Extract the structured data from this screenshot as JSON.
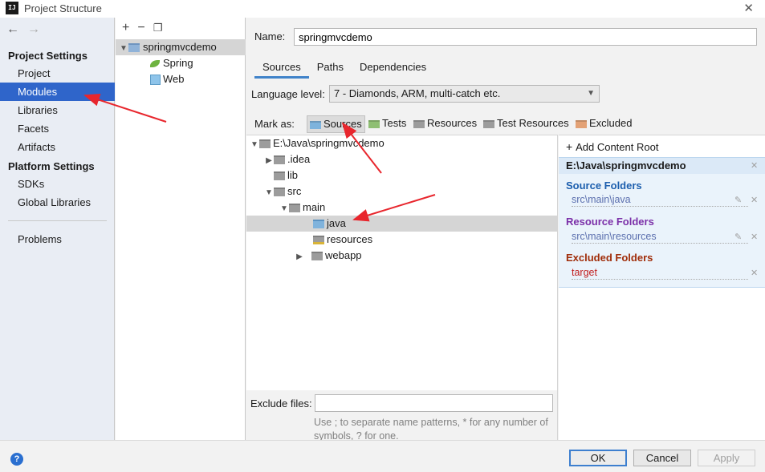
{
  "window": {
    "title": "Project Structure",
    "app_icon_text": "IJ"
  },
  "nav": {
    "back_icon": "arrow-left-icon",
    "forward_icon": "arrow-right-icon",
    "project_settings_header": "Project Settings",
    "project_settings_items": [
      "Project",
      "Modules",
      "Libraries",
      "Facets",
      "Artifacts"
    ],
    "platform_settings_header": "Platform Settings",
    "platform_settings_items": [
      "SDKs",
      "Global Libraries"
    ],
    "other_items": [
      "Problems"
    ],
    "selected": "Modules"
  },
  "modules": {
    "toolbar": {
      "add": "+",
      "remove": "−",
      "copy_icon": "copy-icon"
    },
    "tree": [
      {
        "label": "springmvcdemo",
        "icon": "module-folder-icon",
        "expanded": true,
        "selected": true
      },
      {
        "label": "Spring",
        "icon": "spring-leaf-icon"
      },
      {
        "label": "Web",
        "icon": "web-icon"
      }
    ]
  },
  "details": {
    "name_label": "Name:",
    "name_value": "springmvcdemo",
    "tabs": [
      "Sources",
      "Paths",
      "Dependencies"
    ],
    "active_tab": "Sources",
    "language_level_label": "Language level:",
    "language_level_value": "7 - Diamonds, ARM, multi-catch etc.",
    "mark_as_label": "Mark as:",
    "mark_as_options": [
      {
        "label": "Sources",
        "color": "#7eb3dc",
        "pressed": true
      },
      {
        "label": "Tests",
        "color": "#8fbf73"
      },
      {
        "label": "Resources",
        "color": "#9c9c9c"
      },
      {
        "label": "Test Resources",
        "color": "#9c9c9c"
      },
      {
        "label": "Excluded",
        "color": "#e3a175"
      }
    ],
    "file_tree": [
      {
        "label": "E:\\Java\\springmvcdemo",
        "expander": "expanded",
        "folder": "gray"
      },
      {
        "label": ".idea",
        "expander": "collapsed",
        "folder": "gray"
      },
      {
        "label": "lib",
        "expander": "none",
        "folder": "gray"
      },
      {
        "label": "src",
        "expander": "expanded",
        "folder": "gray"
      },
      {
        "label": "main",
        "expander": "expanded",
        "folder": "gray"
      },
      {
        "label": "java",
        "expander": "none",
        "folder": "blue",
        "selected": true
      },
      {
        "label": "resources",
        "expander": "none",
        "folder": "resource"
      },
      {
        "label": "webapp",
        "expander": "collapsed",
        "folder": "gray"
      }
    ],
    "exclude_files_label": "Exclude files:",
    "exclude_files_value": "",
    "exclude_hint": "Use ; to separate name patterns, * for any number of symbols, ? for one."
  },
  "content_roots": {
    "add_label": "Add Content Root",
    "root_path": "E:\\Java\\springmvcdemo",
    "source_folders_header": "Source Folders",
    "source_folders": [
      "src\\main\\java"
    ],
    "resource_folders_header": "Resource Folders",
    "resource_folders": [
      "src\\main\\resources"
    ],
    "excluded_folders_header": "Excluded Folders",
    "excluded_folders": [
      "target"
    ]
  },
  "footer": {
    "help_icon": "help-icon",
    "ok": "OK",
    "cancel": "Cancel",
    "apply": "Apply"
  },
  "annotations": {
    "arrow_color": "#e8262d",
    "arrow_count": 3
  }
}
